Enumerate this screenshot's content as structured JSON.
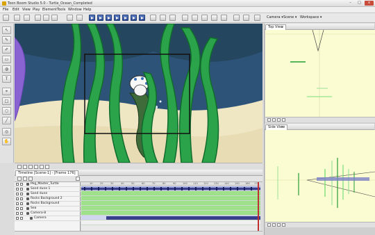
{
  "window": {
    "title": "Toon Boom Studio 5.0 - Turtle_Ocean_Completed",
    "buttons": [
      "–",
      "□",
      "x"
    ]
  },
  "menu": [
    "File",
    "Edit",
    "View",
    "Play",
    "Element",
    "Tools",
    "Window",
    "Help"
  ],
  "toolbar": {
    "camera_label": "Camera",
    "scene_label": "Scene",
    "workspace_label": "Workspace"
  },
  "top_view": {
    "tab": "Top View"
  },
  "side_view": {
    "tab": "Side View"
  },
  "timeline": {
    "tab": "Timeline [Scene-1] - [Frame 176]",
    "ruler_ticks": [
      "10",
      "20",
      "30",
      "40",
      "50",
      "60",
      "70",
      "80",
      "90",
      "100",
      "110",
      "120",
      "130",
      "140",
      "150",
      "160",
      "170"
    ],
    "layers": [
      {
        "name": "Peg_Master_Turtle"
      },
      {
        "name": "Sand dune 1"
      },
      {
        "name": "Sand dune"
      },
      {
        "name": "Rocks Background 2"
      },
      {
        "name": "Rocks Background"
      },
      {
        "name": "Sea"
      },
      {
        "name": "Camera-8"
      },
      {
        "name": "Camera"
      }
    ]
  },
  "colors": {
    "seaweed": "#2aa34a",
    "seaweed_dark": "#116b2c",
    "sea": "#2d5478",
    "sand": "#efe6c4",
    "purple": "#8a63d2",
    "frames_green": "#9fe08a",
    "frames_purple": "#9aa0d8"
  }
}
